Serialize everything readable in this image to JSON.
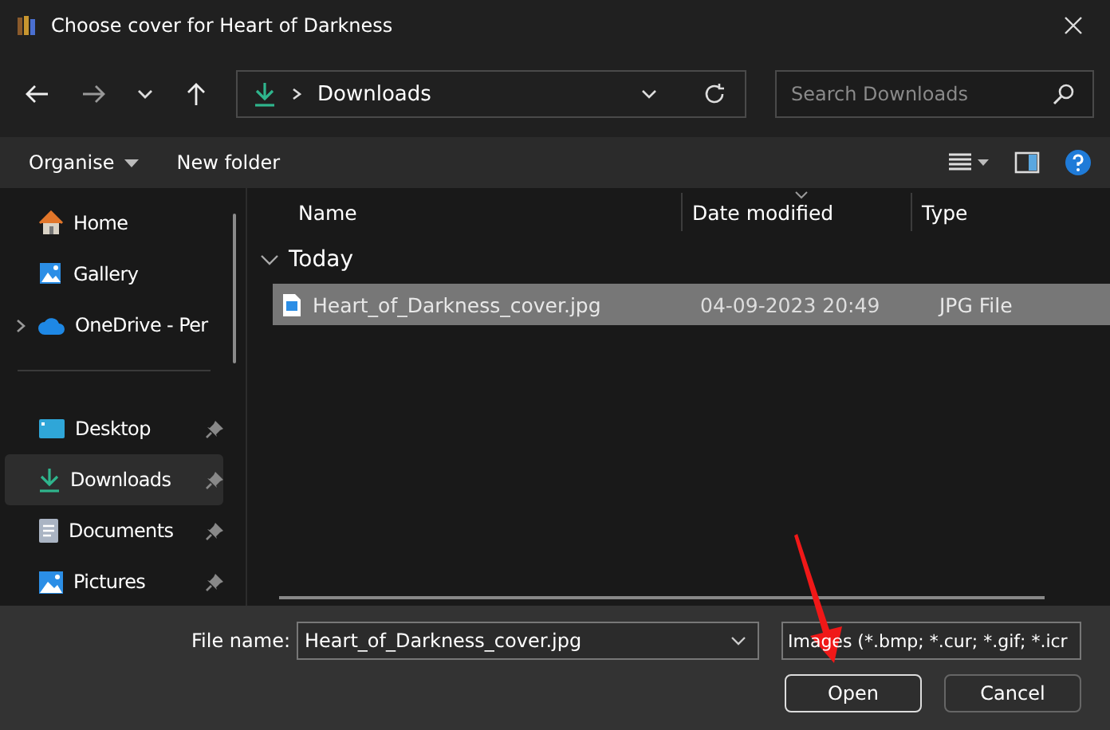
{
  "window": {
    "title": "Choose cover for Heart of Darkness"
  },
  "address": {
    "location": "Downloads"
  },
  "search": {
    "placeholder": "Search Downloads"
  },
  "commands": [
    {
      "label": "Organise",
      "dropdown": true
    },
    {
      "label": "New folder",
      "dropdown": false
    }
  ],
  "sidebar": {
    "items": [
      {
        "label": "Home",
        "expandable": false,
        "pinned": false,
        "selected": false
      },
      {
        "label": "Gallery",
        "expandable": false,
        "pinned": false,
        "selected": false
      },
      {
        "label": "OneDrive - Per",
        "expandable": true,
        "pinned": false,
        "selected": false
      },
      {
        "kind": "divider"
      },
      {
        "label": "Desktop",
        "expandable": false,
        "pinned": true,
        "selected": false
      },
      {
        "label": "Downloads",
        "expandable": false,
        "pinned": true,
        "selected": true
      },
      {
        "label": "Documents",
        "expandable": false,
        "pinned": true,
        "selected": false
      },
      {
        "label": "Pictures",
        "expandable": false,
        "pinned": true,
        "selected": false
      }
    ]
  },
  "table": {
    "columns": [
      "Name",
      "Date modified",
      "Type"
    ],
    "groups": [
      {
        "label": "Today",
        "expanded": true,
        "rows": [
          {
            "name": "Heart_of_Darkness_cover.jpg",
            "date": "04-09-2023 20:49",
            "type": "JPG File",
            "selected": true
          }
        ]
      }
    ]
  },
  "footer": {
    "file_name_label": "File name:",
    "file_name": "Heart_of_Darkness_cover.jpg",
    "filter": "Images (*.bmp; *.cur; *.gif; *.icr",
    "buttons": [
      {
        "label": "Open",
        "default": true
      },
      {
        "label": "Cancel",
        "default": false
      }
    ]
  }
}
